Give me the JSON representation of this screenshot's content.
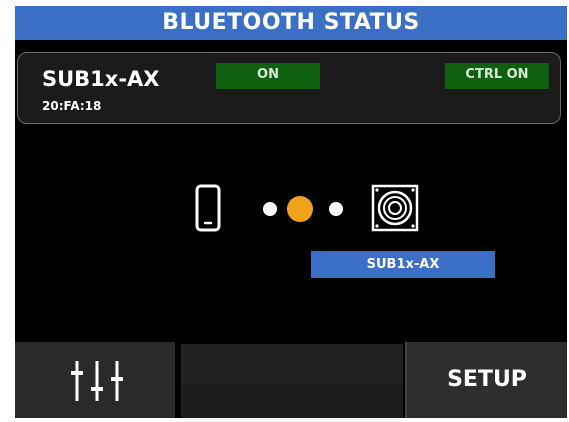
{
  "header": {
    "title": "BLUETOOTH STATUS"
  },
  "device": {
    "name": "SUB1x-AX",
    "address": "20:FA:18",
    "status_badge": "ON",
    "control_badge": "CTRL ON"
  },
  "connection": {
    "source_icon": "phone-icon",
    "target_icon": "speaker-icon",
    "target_label": "SUB1x-AX",
    "accent_color": "#f0a31c"
  },
  "footer": {
    "mixer_icon": "mixer-faders-icon",
    "setup_label": "SETUP"
  },
  "colors": {
    "title_bar": "#3b6fc6",
    "badge_green": "#0e5f0e",
    "background": "#000000"
  }
}
